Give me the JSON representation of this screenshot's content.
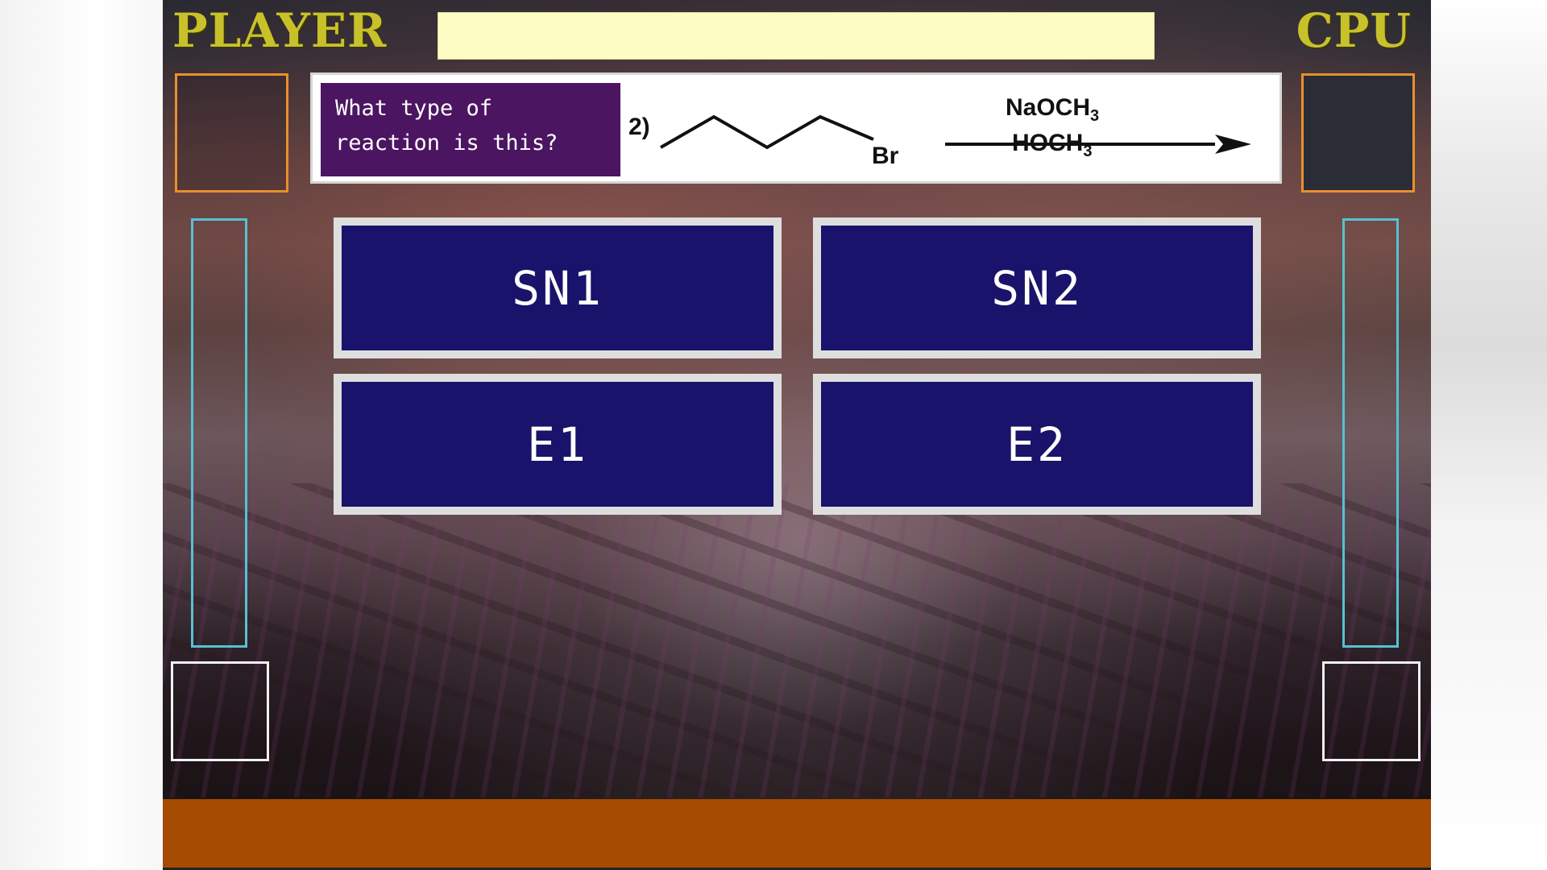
{
  "header": {
    "player_label": "PLAYER",
    "cpu_label": "CPU",
    "message": ""
  },
  "question": {
    "text_line1": "What type of",
    "text_line2": "reaction is this?",
    "number": "2)",
    "leaving_group": "Br",
    "reagent_top": "NaOCH",
    "reagent_top_sub": "3",
    "reagent_bottom": "HOCH",
    "reagent_bottom_sub": "3"
  },
  "answers": [
    {
      "label": "SN1"
    },
    {
      "label": "SN2"
    },
    {
      "label": "E1"
    },
    {
      "label": "E2"
    }
  ],
  "colors": {
    "title": "#c8c12a",
    "message_bar": "#fdfcc3",
    "portrait_border": "#e8902c",
    "hp_border": "#56c1d3",
    "question_box": "#4b1561",
    "answer_bg": "#1a136b",
    "answer_border": "#dedede",
    "bottom_bar": "#a64b02"
  }
}
